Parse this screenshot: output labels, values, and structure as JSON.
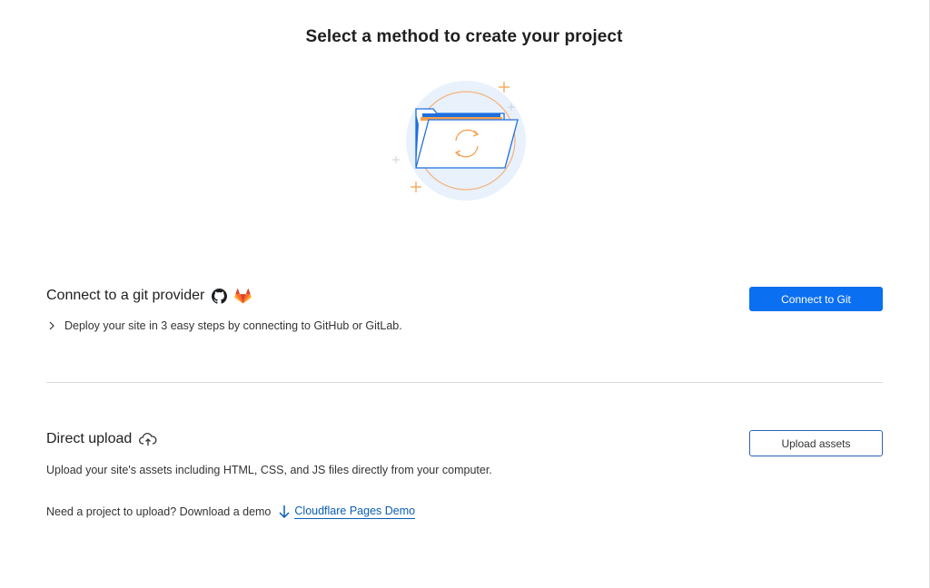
{
  "page": {
    "title": "Select a method to create your project"
  },
  "git_section": {
    "title": "Connect to a git provider",
    "description": "Deploy your site in 3 easy steps by connecting to GitHub or GitLab.",
    "button_label": "Connect to Git",
    "icons": [
      "github-icon",
      "gitlab-icon",
      "chevron-right-icon"
    ]
  },
  "upload_section": {
    "title": "Direct upload",
    "description": "Upload your site's assets including HTML, CSS, and JS files directly from your computer.",
    "demo_prompt": "Need a project to upload? Download a demo",
    "demo_link": "Cloudflare Pages Demo",
    "button_label": "Upload assets",
    "icons": [
      "cloud-upload-icon",
      "download-icon"
    ]
  },
  "colors": {
    "primary": "#0b6ff2",
    "link": "#0a5fb4",
    "accent_orange": "#f6a04d",
    "illustration_bg": "#e8f1fc"
  }
}
